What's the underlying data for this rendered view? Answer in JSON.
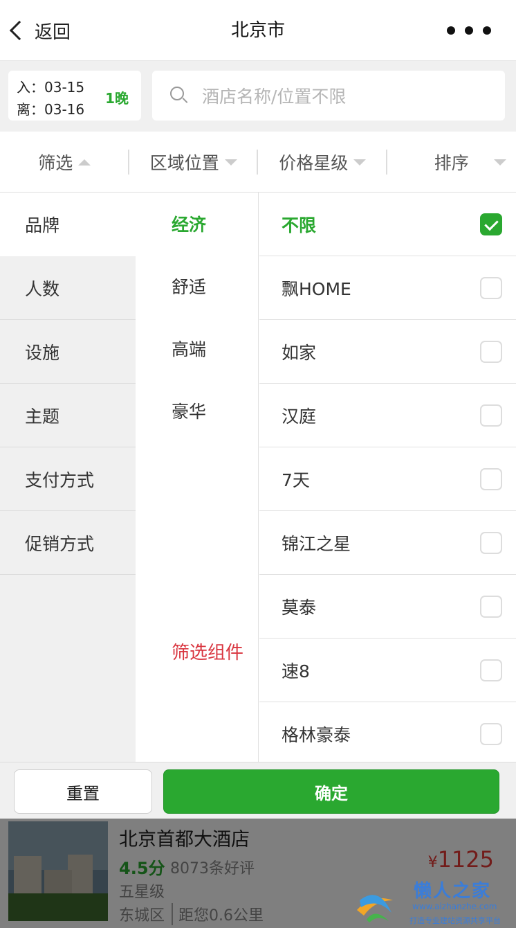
{
  "nav": {
    "back_label": "返回",
    "title": "北京市",
    "more_icon": "more-dots-icon"
  },
  "dates": {
    "checkin": "入：03-15",
    "checkout": "离：03-16",
    "nights": "1晚"
  },
  "search": {
    "placeholder": "酒店名称/位置不限"
  },
  "tabs": [
    {
      "label": "筛选",
      "arrow": "up"
    },
    {
      "label": "区域位置",
      "arrow": "down"
    },
    {
      "label": "价格星级",
      "arrow": "down"
    },
    {
      "label": "排序",
      "arrow": "down"
    }
  ],
  "filter": {
    "categories": [
      "品牌",
      "人数",
      "设施",
      "主题",
      "支付方式",
      "促销方式"
    ],
    "active_category": "品牌",
    "levels": [
      "经济",
      "舒适",
      "高端",
      "豪华"
    ],
    "active_level": "经济",
    "component_label": "筛选组件",
    "options": [
      {
        "label": "不限",
        "checked": true
      },
      {
        "label": "飘HOME",
        "checked": false
      },
      {
        "label": "如家",
        "checked": false
      },
      {
        "label": "汉庭",
        "checked": false
      },
      {
        "label": "7天",
        "checked": false
      },
      {
        "label": "锦江之星",
        "checked": false
      },
      {
        "label": "莫泰",
        "checked": false
      },
      {
        "label": "速8",
        "checked": false
      },
      {
        "label": "格林豪泰",
        "checked": false
      }
    ]
  },
  "actions": {
    "reset": "重置",
    "confirm": "确定"
  },
  "hotel": {
    "name": "北京首都大酒店",
    "score": "4.5分",
    "reviews": "8073条好评",
    "star": "五星级",
    "area": "东城区",
    "distance": "距您0.6公里",
    "currency": "¥",
    "price": "1125"
  },
  "watermark": {
    "title": "懒人之家",
    "url": "www.aizhanzhe.com",
    "slogan": "打造专业建站资源共享平台"
  },
  "colors": {
    "accent": "#2aa830",
    "price": "#e53935",
    "component_label": "#d9353f"
  }
}
